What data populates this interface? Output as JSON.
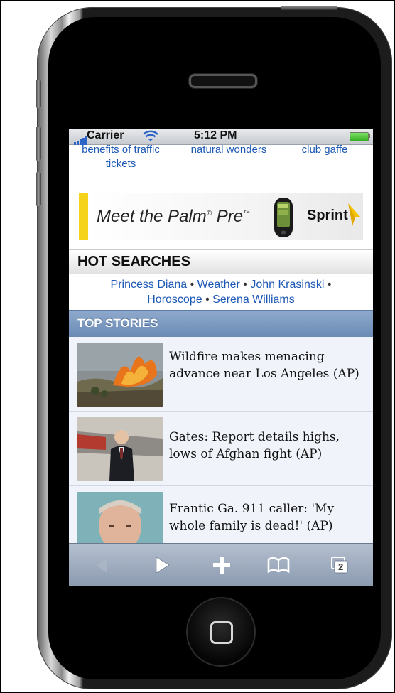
{
  "status_bar": {
    "carrier": "Carrier",
    "time": "5:12 PM",
    "signal_icon": "signal-bars-icon",
    "wifi_icon": "wifi-icon",
    "battery_icon": "battery-icon"
  },
  "trending": {
    "items": [
      {
        "line1": "benefits of traffic",
        "line2": "tickets"
      },
      {
        "line1": "natural wonders",
        "line2": ""
      },
      {
        "line1": "club gaffe",
        "line2": ""
      }
    ]
  },
  "ad": {
    "text": "Meet the Palm",
    "registered": "®",
    "pre": " Pre",
    "tm": "™",
    "brand": "Sprint",
    "accent": "#f5d21c"
  },
  "hot_searches": {
    "title": "HOT SEARCHES",
    "links": [
      "Princess Diana",
      "Weather",
      "John Krasinski",
      "Horoscope",
      "Serena Williams"
    ],
    "separator": "•"
  },
  "top_stories": {
    "title": "TOP STORIES",
    "items": [
      {
        "title": "Wildfire makes menacing advance near Los Angeles (AP)",
        "thumb": "wildfire-photo"
      },
      {
        "title": "Gates: Report details highs, lows of Afghan fight (AP)",
        "thumb": "gates-photo"
      },
      {
        "title": "Frantic Ga. 911 caller: 'My whole family is dead!' (AP)",
        "thumb": "man-portrait-photo"
      }
    ]
  },
  "toolbar": {
    "back_icon": "back-arrow-icon",
    "forward_icon": "forward-arrow-icon",
    "add_icon": "plus-icon",
    "bookmarks_icon": "book-icon",
    "pages_icon": "pages-icon",
    "pages_count": "2"
  },
  "colors": {
    "link": "#1c58b5",
    "top_stories_header": "#7d9ac0",
    "toolbar": "#a1adc0"
  }
}
